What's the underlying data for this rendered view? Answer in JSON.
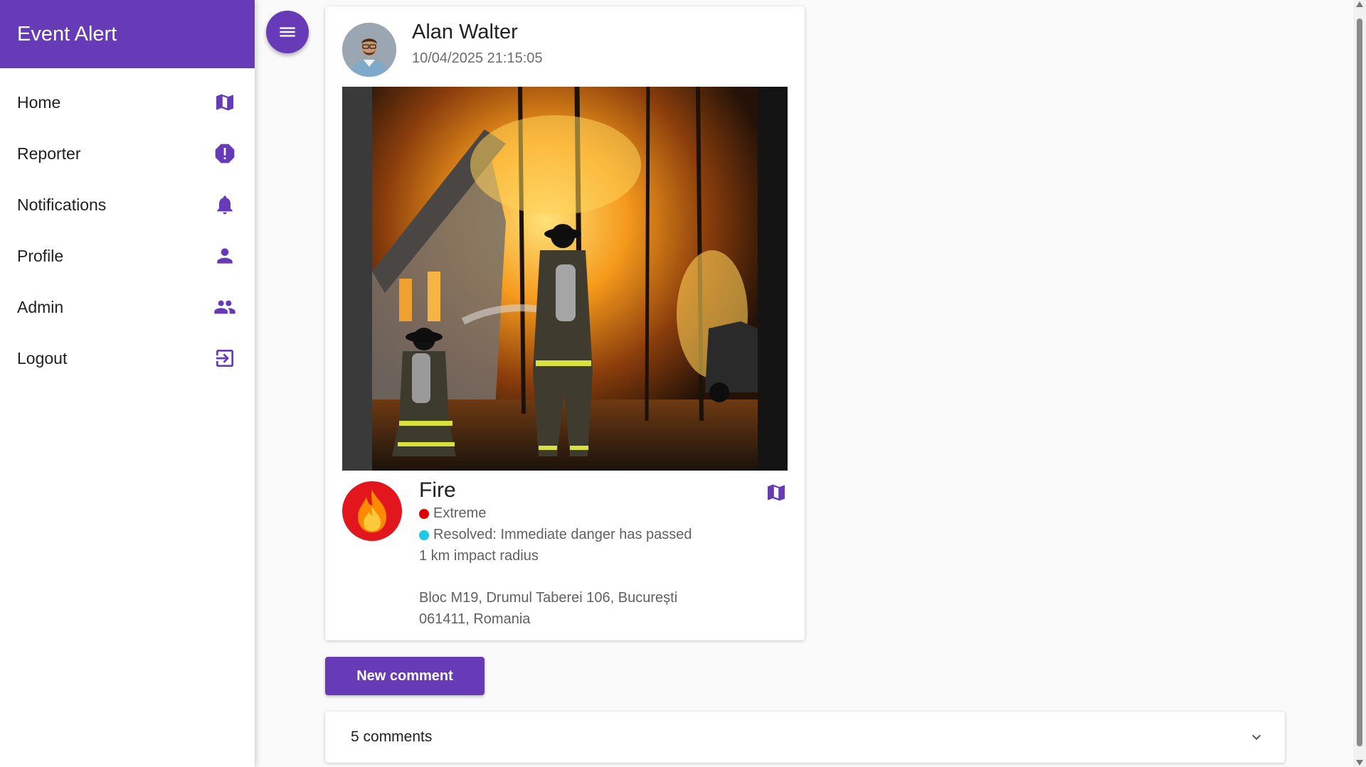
{
  "app": {
    "title": "Event Alert",
    "accent": "#673ab7"
  },
  "sidebar": {
    "items": [
      {
        "label": "Home",
        "icon": "map-icon"
      },
      {
        "label": "Reporter",
        "icon": "alert-icon"
      },
      {
        "label": "Notifications",
        "icon": "bell-icon"
      },
      {
        "label": "Profile",
        "icon": "person-icon"
      },
      {
        "label": "Admin",
        "icon": "people-icon"
      },
      {
        "label": "Logout",
        "icon": "logout-icon"
      }
    ]
  },
  "post": {
    "author": "Alan Walter",
    "timestamp": "10/04/2025 21:15:05",
    "event_type": "Fire",
    "severity": {
      "label": "Extreme",
      "color": "#e00000"
    },
    "status": {
      "label": "Resolved: Immediate danger has passed",
      "color": "#1ec8e8"
    },
    "radius": "1 km impact radius",
    "address_line1": "Bloc M19, Drumul Taberei 106, București",
    "address_line2": "061411, Romania"
  },
  "actions": {
    "new_comment": "New comment"
  },
  "comments": {
    "summary": "5 comments"
  }
}
